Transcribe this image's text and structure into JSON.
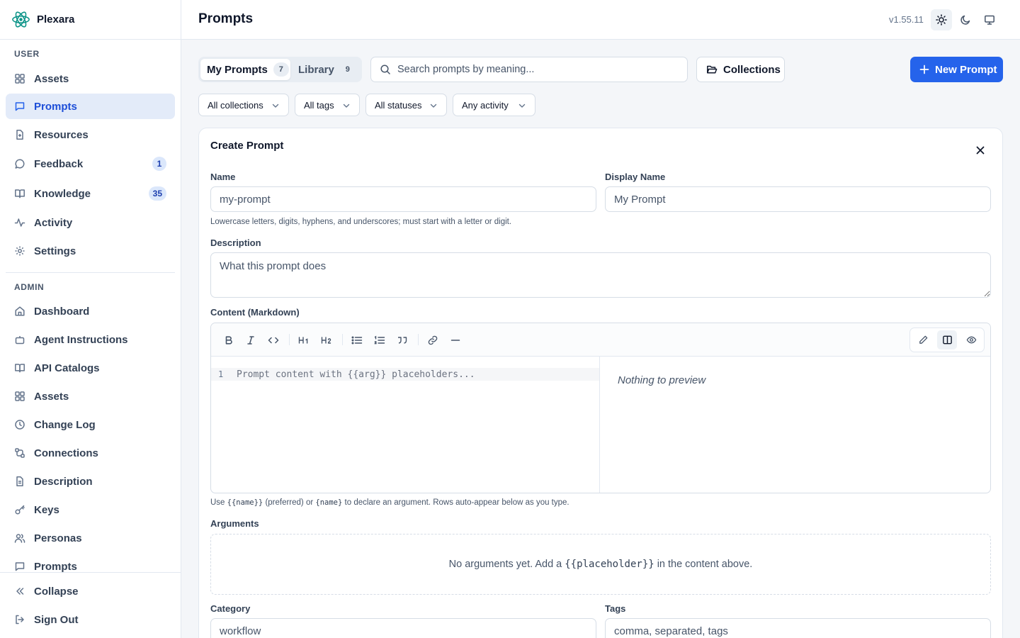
{
  "app": {
    "name": "Plexara",
    "version": "v1.55.11"
  },
  "sidebar": {
    "user_label": "USER",
    "user_items": [
      {
        "label": "Assets",
        "icon": "grid-icon"
      },
      {
        "label": "Prompts",
        "icon": "message-square-icon",
        "active": true
      },
      {
        "label": "Resources",
        "icon": "file-plus-icon"
      },
      {
        "label": "Feedback",
        "icon": "message-circle-icon",
        "badge": "1"
      },
      {
        "label": "Knowledge",
        "icon": "book-open-icon",
        "badge": "35"
      },
      {
        "label": "Activity",
        "icon": "activity-icon"
      },
      {
        "label": "Settings",
        "icon": "gear-icon"
      }
    ],
    "admin_label": "ADMIN",
    "admin_items": [
      {
        "label": "Dashboard",
        "icon": "home-icon"
      },
      {
        "label": "Agent Instructions",
        "icon": "bot-icon"
      },
      {
        "label": "API Catalogs",
        "icon": "book-open-icon"
      },
      {
        "label": "Assets",
        "icon": "grid-icon"
      },
      {
        "label": "Change Log",
        "icon": "clock-icon"
      },
      {
        "label": "Connections",
        "icon": "cable-icon"
      },
      {
        "label": "Description",
        "icon": "file-text-icon"
      },
      {
        "label": "Keys",
        "icon": "key-icon"
      },
      {
        "label": "Personas",
        "icon": "users-icon"
      },
      {
        "label": "Prompts",
        "icon": "message-square-icon"
      }
    ],
    "footer": {
      "collapse": "Collapse",
      "sign_out": "Sign Out"
    }
  },
  "header": {
    "title": "Prompts",
    "theme": "light"
  },
  "toolbar": {
    "tabs": [
      {
        "label": "My Prompts",
        "count": "7",
        "active": true
      },
      {
        "label": "Library",
        "count": "9"
      }
    ],
    "search_placeholder": "Search prompts by meaning...",
    "collections_label": "Collections",
    "new_prompt_label": "New Prompt"
  },
  "filters": [
    "All collections",
    "All tags",
    "All statuses",
    "Any activity"
  ],
  "form": {
    "title": "Create Prompt",
    "name_label": "Name",
    "name_placeholder": "my-prompt",
    "name_hint": "Lowercase letters, digits, hyphens, and underscores; must start with a letter or digit.",
    "display_name_label": "Display Name",
    "display_name_placeholder": "My Prompt",
    "description_label": "Description",
    "description_placeholder": "What this prompt does",
    "content_label": "Content (Markdown)",
    "editor_line_number": "1",
    "editor_placeholder": "Prompt content with {{arg}} placeholders...",
    "preview_empty": "Nothing to preview",
    "content_hint_prefix": "Use",
    "content_hint_code1": "{{name}}",
    "content_hint_mid": "(preferred) or",
    "content_hint_code2": "{name}",
    "content_hint_suffix": "to declare an argument. Rows auto-appear below as you type.",
    "arguments_label": "Arguments",
    "arguments_empty_prefix": "No arguments yet. Add a",
    "arguments_empty_code": "{{placeholder}}",
    "arguments_empty_suffix": "in the content above.",
    "category_label": "Category",
    "category_placeholder": "workflow",
    "tags_label": "Tags",
    "tags_placeholder": "comma, separated, tags"
  },
  "colors": {
    "accent": "#2563eb",
    "active_nav_bg": "#e3ebf9",
    "sidebar_bg": "#ffffff",
    "page_bg": "#f4f6f9"
  }
}
